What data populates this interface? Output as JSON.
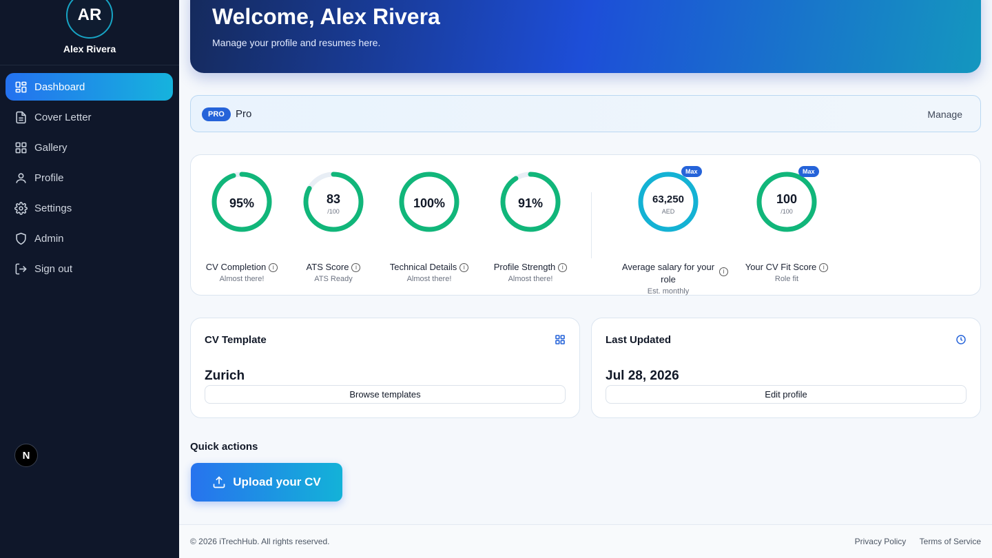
{
  "user": {
    "initials": "AR",
    "name": "Alex Rivera"
  },
  "sidebar": {
    "items": [
      {
        "label": "Dashboard",
        "icon": "dashboard-grid-icon",
        "active": true
      },
      {
        "label": "Cover Letter",
        "icon": "document-icon"
      },
      {
        "label": "Gallery",
        "icon": "grid-icon"
      },
      {
        "label": "Profile",
        "icon": "user-icon"
      },
      {
        "label": "Settings",
        "icon": "gear-icon"
      },
      {
        "label": "Admin",
        "icon": "shield-icon"
      },
      {
        "label": "Sign out",
        "icon": "sign-out-icon"
      }
    ],
    "badge": "N"
  },
  "hero": {
    "title": "Welcome, Alex Rivera",
    "subtitle": "Manage your profile and resumes here."
  },
  "plan": {
    "badge": "PRO",
    "name": "Pro",
    "manage_label": "Manage"
  },
  "scores": [
    {
      "value": "95%",
      "label": "CV Completion",
      "hint": "Almost there!",
      "progress": 0.95,
      "color": "#11b67a"
    },
    {
      "value": "83",
      "unit": "/100",
      "label": "ATS Score",
      "hint": "ATS Ready",
      "progress": 0.83,
      "color": "#11b67a"
    },
    {
      "value": "100%",
      "label": "Technical Details",
      "hint": "Almost there!",
      "progress": 1.0,
      "color": "#11b67a"
    },
    {
      "value": "91%",
      "label": "Profile Strength",
      "hint": "Almost there!",
      "progress": 0.91,
      "color": "#11b67a"
    },
    {
      "value": "63,250",
      "unit": "AED",
      "label_line1": "Average salary for your",
      "label_line2": "role",
      "hint": "Est. monthly",
      "badge": "Max",
      "progress": 1.0,
      "color": "#14b2d4"
    },
    {
      "value": "100",
      "unit": "/100",
      "label": "Your CV Fit Score",
      "hint": "Role fit",
      "badge": "Max",
      "progress": 1.0,
      "color": "#11b67a"
    }
  ],
  "cv_template": {
    "title": "CV Template",
    "value": "Zurich",
    "button": "Browse templates",
    "icon": "grid-icon"
  },
  "last_updated": {
    "title": "Last Updated",
    "value": "Jul 28, 2026",
    "button": "Edit profile",
    "icon": "clock-icon"
  },
  "quick_actions": {
    "title": "Quick actions",
    "upload_label": "Upload your CV",
    "upload_icon": "upload-icon"
  },
  "footer": {
    "copyright": "© 2026 iTrechHub. All rights reserved.",
    "privacy": "Privacy Policy",
    "terms": "Terms of Service"
  },
  "colors": {
    "sidebar_bg": "#0f172a",
    "accent_blue": "#2563d9",
    "accent_cyan": "#14b2d4",
    "ring_green": "#11b67a"
  }
}
